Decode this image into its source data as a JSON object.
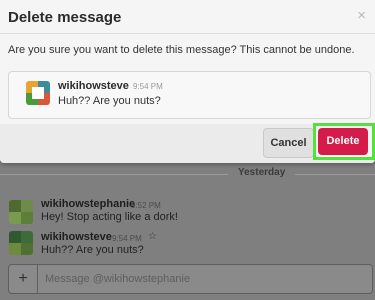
{
  "modal": {
    "title": "Delete message",
    "close_glyph": "×",
    "prompt": "Are you sure you want to delete this message? This cannot be undone.",
    "preview": {
      "user": "wikihowsteve",
      "time": "9:54 PM",
      "text": "Huh?? Are you nuts?"
    },
    "cancel_label": "Cancel",
    "delete_label": "Delete",
    "colors": {
      "delete": "#d51b4a",
      "highlight": "#52e23a"
    }
  },
  "chat": {
    "divider_label": "Yesterday",
    "messages": [
      {
        "user": "wikihowstephanie",
        "time": "9:52 PM",
        "text": "Hey! Stop acting like a dork!"
      },
      {
        "user": "wikihowsteve",
        "time": "9:54 PM",
        "text": "Huh?? Are you nuts?",
        "icon": "star-icon"
      }
    ],
    "composer": {
      "plus_glyph": "+",
      "placeholder": "Message @wikihowstephanie"
    }
  }
}
